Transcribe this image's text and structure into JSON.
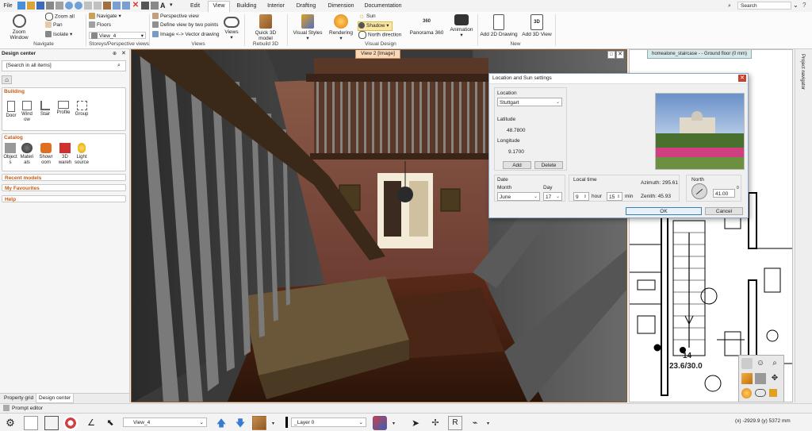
{
  "menubar": {
    "file": "File",
    "tabs": [
      "Edit",
      "View",
      "Building",
      "Interior",
      "Drafting",
      "Dimension",
      "Documentation"
    ],
    "active_tab": "View",
    "search_placeholder": "Search"
  },
  "ribbon": {
    "navigate": {
      "zoom_window": "Zoom Window",
      "zoom_all": "Zoom all",
      "pan": "Pan",
      "isolate": "Isolate",
      "label": "Navigate"
    },
    "storeys": {
      "navigate": "Navigate",
      "floors": "Floors",
      "view_value": "View_4",
      "label": "Storeys/Perspective views"
    },
    "views": {
      "perspective": "Perspective view",
      "define_two_points": "Define view by two points",
      "image_vector": "Image <-> Vector drawing",
      "views_btn": "Views",
      "label": "Views"
    },
    "rebuild": {
      "quick_3d": "Quick 3D model",
      "label": "Rebuild 3D"
    },
    "visual_design": {
      "visual_styles": "Visual Styles",
      "rendering": "Rendering",
      "sun": "Sun",
      "shadow": "Shadow",
      "north_direction": "North direction",
      "panorama": "Panorama 360",
      "animation": "Animation",
      "label": "Visual Design"
    },
    "new": {
      "add_2d": "Add 2D Drawing",
      "add_3d": "Add 3D View",
      "label": "New"
    }
  },
  "design_center": {
    "title": "Design center",
    "search_placeholder": "[Search in all items]",
    "building": {
      "header": "Building",
      "items": [
        "Door",
        "Wind ow",
        "Stair",
        "Profile",
        "Group"
      ]
    },
    "catalog": {
      "header": "Catalog",
      "items": [
        "Object s",
        "Materi als",
        "Showr oom",
        "3D wareh",
        "Light source"
      ]
    },
    "recent": "Recent models",
    "favourites": "My Favourites",
    "help": "Help",
    "bottom_tabs": [
      "Property grid",
      "Design center"
    ]
  },
  "viewport": {
    "tab_title": "View 2 [Image]"
  },
  "plan": {
    "tab_title": "homealone_staircase - - Ground floor (0 mm)",
    "stair_number": "14",
    "stair_dims": "23.6/30.0"
  },
  "project_navigator": "Project navigator",
  "dialog": {
    "title": "Location and Sun settings",
    "location_label": "Location",
    "location_value": "Stuttgart",
    "latitude_label": "Latitude",
    "latitude_value": "48.7800",
    "longitude_label": "Longitude",
    "longitude_value": "9.1700",
    "add": "Add",
    "delete": "Delete",
    "date_label": "Date",
    "month_label": "Month",
    "month_value": "June",
    "day_label": "Day",
    "day_value": "17",
    "local_time_label": "Local time",
    "hour_value": "9",
    "hour_label": "hour",
    "min_value": "15",
    "min_label": "min",
    "azimuth": "Azimuth: 295.61",
    "zenith": "Zenith: 45.93",
    "north_label": "North",
    "north_value": "41.00",
    "degree": "0",
    "ok": "OK",
    "cancel": "Cancel"
  },
  "prompt_editor": "Prompt editor",
  "statusbar": {
    "view_value": "View_4",
    "layer_value": "_Layer 0",
    "coords": "(x) -2929.9   (y) 5372 mm"
  },
  "colors": {
    "accent": "#c85a10",
    "dialog_border": "#8aa6c8",
    "ok_border": "#3c7fb1"
  }
}
